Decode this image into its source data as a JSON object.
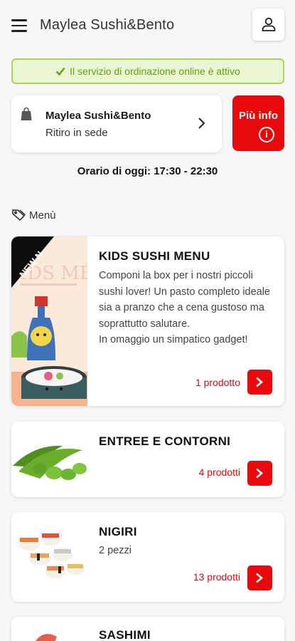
{
  "header": {
    "title": "Maylea Sushi&Bento"
  },
  "banner": {
    "text": "Il servizio di ordinazione online è attivo"
  },
  "store": {
    "name": "Maylea Sushi&Bento",
    "mode": "Ritiro in sede"
  },
  "info_button": {
    "label": "Più info",
    "icon": "i"
  },
  "hours": "Orario di oggi: 17:30 - 22:30",
  "menu_label": "Menù",
  "kids_badge": "NEW N",
  "kids_image_text": "IDS MEN",
  "categories": [
    {
      "title": "KIDS SUSHI MENU",
      "description": "Componi la box per i nostri piccoli sushi lover! Un pasto completo ideale sia a pranzo che a cena gustoso ma soprattutto salutare.\nIn omaggio un simpatico gadget!",
      "count": "1 prodotto"
    },
    {
      "title": "ENTREE E CONTORNI",
      "description": "",
      "count": "4 prodotti"
    },
    {
      "title": "NIGIRI",
      "description": "2 pezzi",
      "count": "13 prodotti"
    },
    {
      "title": "SASHIMI",
      "description": "",
      "count": ""
    }
  ],
  "colors": {
    "accent": "#e8090d",
    "success_bg": "#eaf5d2",
    "success_border": "#a8d35c",
    "success_text": "#62a10a"
  }
}
